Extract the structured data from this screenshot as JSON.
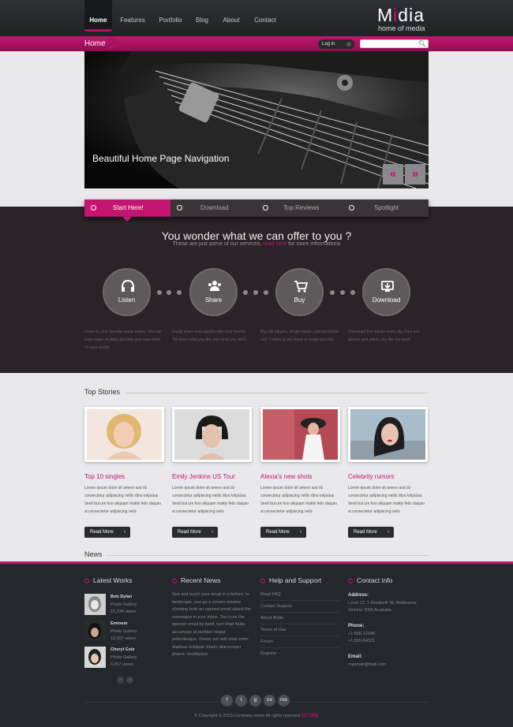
{
  "nav": {
    "items": [
      "Home",
      "Features",
      "Portfolio",
      "Blog",
      "About",
      "Contact"
    ],
    "active": "Home"
  },
  "logo": {
    "main_1": "M",
    "main_2": "i",
    "main_3": "dia",
    "tagline": "home of media"
  },
  "breadcrumb": "Home",
  "login_label": "Log in",
  "search": {
    "placeholder": ""
  },
  "hero": {
    "caption": "Beautiful Home Page Navigation",
    "prev_icon": "«",
    "next_icon": "»"
  },
  "tabs": [
    "Start Here!",
    "Download",
    "Top Reviews",
    "Spotlight"
  ],
  "offer": {
    "title": "You wonder what we can offer to you ?",
    "subtitle_pre": "These are just some of our services,",
    "subtitle_link": "read here",
    "subtitle_post": "for more informations"
  },
  "services": [
    {
      "label": "Listen",
      "icon": "headphones-icon",
      "desc": "Listen to your favorite music online. You can even make multiple playlists and save them on your profile."
    },
    {
      "label": "Share",
      "icon": "users-icon",
      "desc": "Easily share your playlist with your friends. Tell them what you like and what you don't."
    },
    {
      "label": "Buy",
      "icon": "cart-icon",
      "desc": "Buy full albums, single tracks, concert tickets and T-shirts of any band or singer you like."
    },
    {
      "label": "Download",
      "icon": "download-icon",
      "desc": "Download free tracks every day from any genres and artists you like the most."
    }
  ],
  "top_stories": {
    "title": "Top Stories",
    "items": [
      {
        "title": "Top 10 singles",
        "text": "Lorem ipsum dolor sit amers asd ds consectetur adipiscing nelits dtoo lokjadas Vesti bul um koo aliquam mattis felis daquio sl.consectetur adipiscing nelit.",
        "button": "Read More"
      },
      {
        "title": "Emily Jenkins US Tour",
        "text": "Lorem ipsum dolor sit amers asd ds consectetur adipiscing nelits dtoo lokjadas Vesti bul um koo aliquam mattis felis daquio sl.consectetur adipiscing nelit.",
        "button": "Read More"
      },
      {
        "title": "Alexia's new shots",
        "text": "Lorem ipsum dolor sit amers asd ds consectetur adipiscing nelits dtoo lokjadas Vesti bul um koo aliquam mattis felis daquio sl.consectetur adipiscing nelit.",
        "button": "Read More"
      },
      {
        "title": "Celebrity rumors",
        "text": "Lorem ipsum dolor sit amers asd ds consectetur adipiscing nelits dtoo lokjadas Vesti bul um koo aliquam mattis felis daquio sl.consectetur adipiscing nelit.",
        "button": "Read More"
      }
    ]
  },
  "news_title": "News",
  "footer": {
    "latest_works": {
      "title": "Latest Works",
      "items": [
        {
          "name": "Bob Dylan",
          "category": "Photo Gallery",
          "views": "15,234 views"
        },
        {
          "name": "Eminem",
          "category": "Photo Gallery",
          "views": "12,657 views"
        },
        {
          "name": "Cheryl Cole",
          "category": "Photo Gallery",
          "views": "5,657 views"
        }
      ]
    },
    "recent_news": {
      "title": "Recent News",
      "text": "See and touch your email in a before. In landscape, you go a screen uniview showing both an opened email uiland the messages in your inbox. Too ccee the opened email by itself, turn iPad Nulla accumsan at porttitor neque pellentesque. Donec vel velit vitae enim dapibus volutpat. Etiam ullamcorper pharet. Vestibulum"
    },
    "help": {
      "title": "Help and Support",
      "links": [
        "Read FAQ",
        "Contact Support",
        "About Midia",
        "Terms of Use",
        "Forum",
        "Register"
      ]
    },
    "contact": {
      "title": "Contact info",
      "address_label": "Address:",
      "address_1": "Level 12, 1 Elizabeth St, Melbourne",
      "address_2": "Victoria 3000 Australia",
      "phone_label": "Phone:",
      "phone_1": "+1 555-12345",
      "phone_2": "+1 555-54321",
      "email_label": "Email:",
      "email": "myemail@mail.com"
    },
    "pager": {
      "prev": "‹",
      "next": "›"
    },
    "social": [
      "f",
      "t",
      "g",
      "cs",
      "rss"
    ],
    "copyright_pre": "© Copyright © 2013.Company name All rights reserved.",
    "copyright_brand": "网页模板"
  },
  "colors": {
    "accent": "#c41670",
    "dark": "#24272b",
    "band": "#2a2328"
  }
}
